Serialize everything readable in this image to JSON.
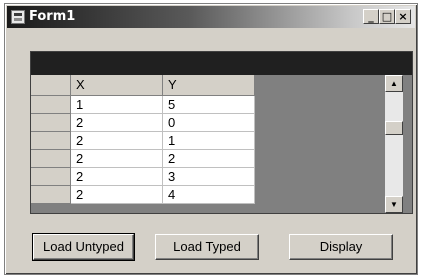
{
  "window": {
    "title": "Form1",
    "minimize_glyph": "_",
    "maximize_glyph": "□",
    "close_glyph": "×"
  },
  "grid": {
    "columns": [
      "X",
      "Y"
    ],
    "rows": [
      {
        "x": "1",
        "y": "5"
      },
      {
        "x": "2",
        "y": "0"
      },
      {
        "x": "2",
        "y": "1"
      },
      {
        "x": "2",
        "y": "2"
      },
      {
        "x": "2",
        "y": "3"
      },
      {
        "x": "2",
        "y": "4"
      }
    ],
    "scroll_up_glyph": "▲",
    "scroll_down_glyph": "▼"
  },
  "buttons": {
    "load_untyped": "Load Untyped",
    "load_typed": "Load Typed",
    "display": "Display"
  }
}
